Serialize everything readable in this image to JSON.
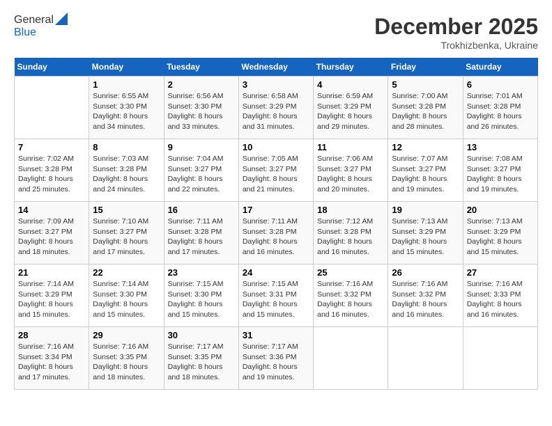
{
  "header": {
    "logo_line1": "General",
    "logo_line2": "Blue",
    "month_year": "December 2025",
    "location": "Trokhizbenka, Ukraine"
  },
  "days_of_week": [
    "Sunday",
    "Monday",
    "Tuesday",
    "Wednesday",
    "Thursday",
    "Friday",
    "Saturday"
  ],
  "weeks": [
    [
      {
        "day": "",
        "info": ""
      },
      {
        "day": "1",
        "info": "Sunrise: 6:55 AM\nSunset: 3:30 PM\nDaylight: 8 hours\nand 34 minutes."
      },
      {
        "day": "2",
        "info": "Sunrise: 6:56 AM\nSunset: 3:30 PM\nDaylight: 8 hours\nand 33 minutes."
      },
      {
        "day": "3",
        "info": "Sunrise: 6:58 AM\nSunset: 3:29 PM\nDaylight: 8 hours\nand 31 minutes."
      },
      {
        "day": "4",
        "info": "Sunrise: 6:59 AM\nSunset: 3:29 PM\nDaylight: 8 hours\nand 29 minutes."
      },
      {
        "day": "5",
        "info": "Sunrise: 7:00 AM\nSunset: 3:28 PM\nDaylight: 8 hours\nand 28 minutes."
      },
      {
        "day": "6",
        "info": "Sunrise: 7:01 AM\nSunset: 3:28 PM\nDaylight: 8 hours\nand 26 minutes."
      }
    ],
    [
      {
        "day": "7",
        "info": "Sunrise: 7:02 AM\nSunset: 3:28 PM\nDaylight: 8 hours\nand 25 minutes."
      },
      {
        "day": "8",
        "info": "Sunrise: 7:03 AM\nSunset: 3:28 PM\nDaylight: 8 hours\nand 24 minutes."
      },
      {
        "day": "9",
        "info": "Sunrise: 7:04 AM\nSunset: 3:27 PM\nDaylight: 8 hours\nand 22 minutes."
      },
      {
        "day": "10",
        "info": "Sunrise: 7:05 AM\nSunset: 3:27 PM\nDaylight: 8 hours\nand 21 minutes."
      },
      {
        "day": "11",
        "info": "Sunrise: 7:06 AM\nSunset: 3:27 PM\nDaylight: 8 hours\nand 20 minutes."
      },
      {
        "day": "12",
        "info": "Sunrise: 7:07 AM\nSunset: 3:27 PM\nDaylight: 8 hours\nand 19 minutes."
      },
      {
        "day": "13",
        "info": "Sunrise: 7:08 AM\nSunset: 3:27 PM\nDaylight: 8 hours\nand 19 minutes."
      }
    ],
    [
      {
        "day": "14",
        "info": "Sunrise: 7:09 AM\nSunset: 3:27 PM\nDaylight: 8 hours\nand 18 minutes."
      },
      {
        "day": "15",
        "info": "Sunrise: 7:10 AM\nSunset: 3:27 PM\nDaylight: 8 hours\nand 17 minutes."
      },
      {
        "day": "16",
        "info": "Sunrise: 7:11 AM\nSunset: 3:28 PM\nDaylight: 8 hours\nand 17 minutes."
      },
      {
        "day": "17",
        "info": "Sunrise: 7:11 AM\nSunset: 3:28 PM\nDaylight: 8 hours\nand 16 minutes."
      },
      {
        "day": "18",
        "info": "Sunrise: 7:12 AM\nSunset: 3:28 PM\nDaylight: 8 hours\nand 16 minutes."
      },
      {
        "day": "19",
        "info": "Sunrise: 7:13 AM\nSunset: 3:29 PM\nDaylight: 8 hours\nand 15 minutes."
      },
      {
        "day": "20",
        "info": "Sunrise: 7:13 AM\nSunset: 3:29 PM\nDaylight: 8 hours\nand 15 minutes."
      }
    ],
    [
      {
        "day": "21",
        "info": "Sunrise: 7:14 AM\nSunset: 3:29 PM\nDaylight: 8 hours\nand 15 minutes."
      },
      {
        "day": "22",
        "info": "Sunrise: 7:14 AM\nSunset: 3:30 PM\nDaylight: 8 hours\nand 15 minutes."
      },
      {
        "day": "23",
        "info": "Sunrise: 7:15 AM\nSunset: 3:30 PM\nDaylight: 8 hours\nand 15 minutes."
      },
      {
        "day": "24",
        "info": "Sunrise: 7:15 AM\nSunset: 3:31 PM\nDaylight: 8 hours\nand 15 minutes."
      },
      {
        "day": "25",
        "info": "Sunrise: 7:16 AM\nSunset: 3:32 PM\nDaylight: 8 hours\nand 16 minutes."
      },
      {
        "day": "26",
        "info": "Sunrise: 7:16 AM\nSunset: 3:32 PM\nDaylight: 8 hours\nand 16 minutes."
      },
      {
        "day": "27",
        "info": "Sunrise: 7:16 AM\nSunset: 3:33 PM\nDaylight: 8 hours\nand 16 minutes."
      }
    ],
    [
      {
        "day": "28",
        "info": "Sunrise: 7:16 AM\nSunset: 3:34 PM\nDaylight: 8 hours\nand 17 minutes."
      },
      {
        "day": "29",
        "info": "Sunrise: 7:16 AM\nSunset: 3:35 PM\nDaylight: 8 hours\nand 18 minutes."
      },
      {
        "day": "30",
        "info": "Sunrise: 7:17 AM\nSunset: 3:35 PM\nDaylight: 8 hours\nand 18 minutes."
      },
      {
        "day": "31",
        "info": "Sunrise: 7:17 AM\nSunset: 3:36 PM\nDaylight: 8 hours\nand 19 minutes."
      },
      {
        "day": "",
        "info": ""
      },
      {
        "day": "",
        "info": ""
      },
      {
        "day": "",
        "info": ""
      }
    ]
  ]
}
